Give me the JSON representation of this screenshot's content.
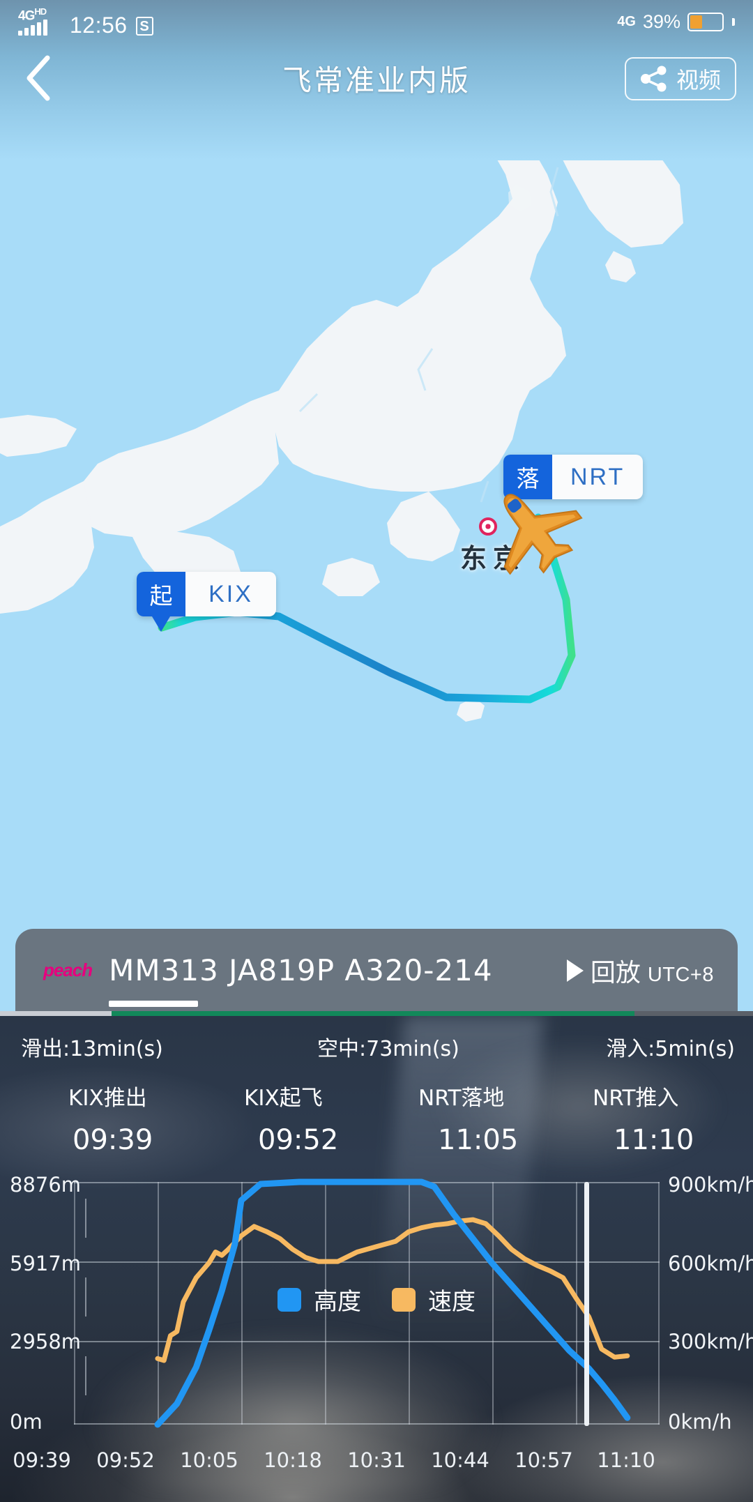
{
  "status_bar": {
    "network_label": "4G",
    "network_sup": "HD",
    "time": "12:56",
    "sim_badge": "S",
    "right_network": "4G",
    "battery_percent": "39%",
    "battery_level": 39
  },
  "top_nav": {
    "back_icon": "chevron-left-icon",
    "title": "飞常准业内版",
    "share_icon": "share-icon",
    "share_label": "视频"
  },
  "map": {
    "origin_marker": {
      "tag": "起",
      "code": "KIX"
    },
    "dest_marker": {
      "tag": "落",
      "code": "NRT"
    },
    "city_label": "东京",
    "plane_icon": "airplane-icon",
    "path_colors": [
      "#3FE08C",
      "#19D6D6",
      "#19B4DC",
      "#1B8FD0",
      "#1C82C8"
    ],
    "land_color": "#F2F5F8",
    "sea_color": "#A8DCF8"
  },
  "flight_bar": {
    "airline_logo": "peach",
    "flight_no": "MM313",
    "registration": "JA819P",
    "aircraft_type": "A320-214",
    "ids_line": "MM313  JA819P  A320-214",
    "playback_icon": "play-icon",
    "playback_label": "回放",
    "timezone": "UTC+8"
  },
  "phases": {
    "durations": [
      "滑出:13min(s)",
      "空中:73min(s)",
      "滑入:5min(s)"
    ],
    "events": [
      {
        "name": "KIX推出",
        "time": "09:39"
      },
      {
        "name": "KIX起飞",
        "time": "09:52"
      },
      {
        "name": "NRT落地",
        "time": "11:05"
      },
      {
        "name": "NRT推入",
        "time": "11:10"
      }
    ]
  },
  "legend": [
    {
      "label": "高度",
      "color": "#2196F3"
    },
    {
      "label": "速度",
      "color": "#F7B961"
    }
  ],
  "chart_data": {
    "type": "line",
    "title": "",
    "xlabel": "",
    "grid": true,
    "legend_position": "inside-center",
    "x_ticks": [
      "09:39",
      "09:52",
      "10:05",
      "10:18",
      "10:31",
      "10:44",
      "10:57",
      "11:10"
    ],
    "y_left": {
      "label": "高度",
      "unit": "m",
      "ticks": [
        "0m",
        "2958m",
        "5917m",
        "8876m"
      ],
      "tick_values": [
        0,
        2958,
        5917,
        8876
      ],
      "range": [
        0,
        8876
      ]
    },
    "y_right": {
      "label": "速度",
      "unit": "km/h",
      "ticks": [
        "0km/h",
        "300km/h",
        "600km/h",
        "900km/h"
      ],
      "tick_values": [
        0,
        300,
        600,
        900
      ],
      "range": [
        0,
        900
      ]
    },
    "series": [
      {
        "name": "高度",
        "color": "#2196F3",
        "axis": "left",
        "unit": "m",
        "x": [
          "09:52",
          "09:55",
          "09:58",
          "10:00",
          "10:02",
          "10:04",
          "10:05",
          "10:08",
          "10:14",
          "10:20",
          "10:26",
          "10:31",
          "10:33",
          "10:35",
          "10:38",
          "10:41",
          "10:44",
          "10:47",
          "10:50",
          "10:53",
          "10:56",
          "10:59",
          "11:01",
          "11:03",
          "11:05"
        ],
        "values": [
          0,
          760,
          2100,
          3450,
          4900,
          6600,
          8200,
          8800,
          8876,
          8876,
          8876,
          8876,
          8876,
          8700,
          7700,
          6800,
          5900,
          5100,
          4300,
          3500,
          2700,
          2050,
          1500,
          900,
          250
        ]
      },
      {
        "name": "速度",
        "color": "#F7B961",
        "axis": "right",
        "unit": "km/h",
        "x": [
          "09:52",
          "09:53",
          "09:54",
          "09:55",
          "09:56",
          "09:58",
          "10:00",
          "10:01",
          "10:02",
          "10:03",
          "10:05",
          "10:07",
          "10:09",
          "10:11",
          "10:13",
          "10:15",
          "10:17",
          "10:20",
          "10:23",
          "10:26",
          "10:29",
          "10:31",
          "10:33",
          "10:35",
          "10:37",
          "10:39",
          "10:41",
          "10:43",
          "10:45",
          "10:47",
          "10:49",
          "10:51",
          "10:53",
          "10:55",
          "10:57",
          "10:59",
          "11:01",
          "11:03",
          "11:05"
        ],
        "values": [
          245,
          238,
          330,
          345,
          455,
          545,
          600,
          640,
          628,
          650,
          700,
          735,
          715,
          690,
          650,
          620,
          605,
          605,
          640,
          660,
          680,
          715,
          730,
          740,
          745,
          755,
          760,
          745,
          700,
          650,
          615,
          590,
          570,
          545,
          470,
          400,
          280,
          250,
          255
        ]
      }
    ]
  }
}
